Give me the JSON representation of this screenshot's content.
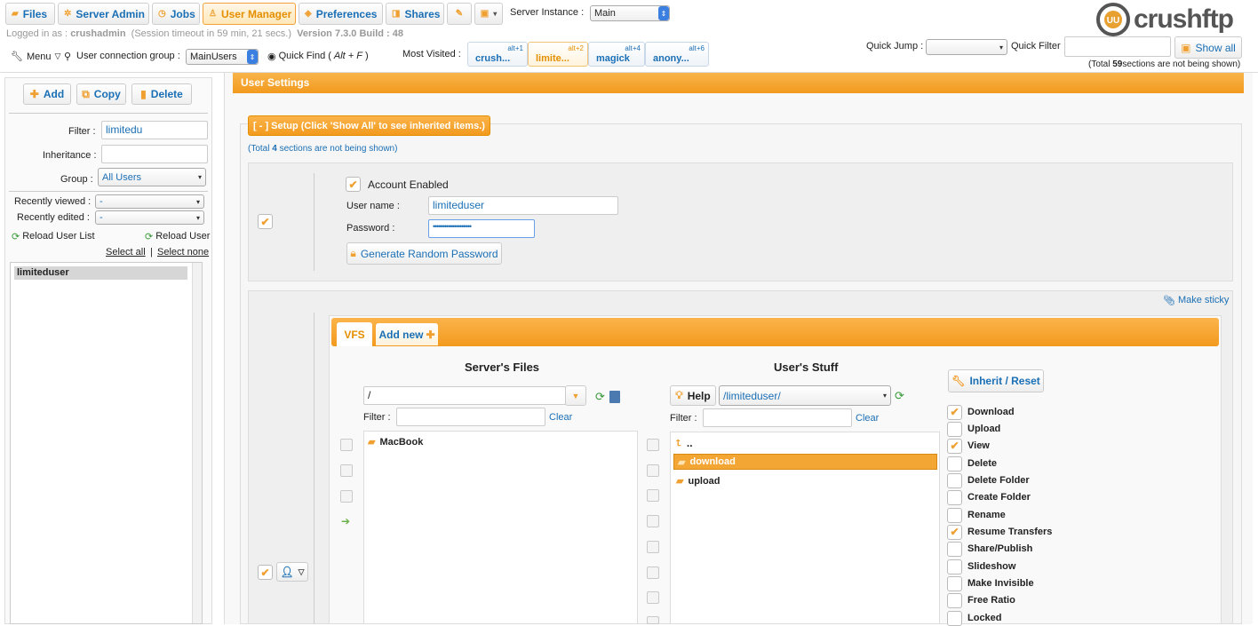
{
  "topnav": {
    "tabs": [
      {
        "label": "Files"
      },
      {
        "label": "Server Admin"
      },
      {
        "label": "Jobs"
      },
      {
        "label": "User Manager"
      },
      {
        "label": "Preferences"
      },
      {
        "label": "Shares"
      }
    ],
    "server_instance_label": "Server Instance :",
    "server_instance_value": "Main",
    "logo": "crushftp"
  },
  "session": {
    "logged_in_label": "Logged in as :",
    "user": "crushadmin",
    "timeout": "(Session timeout in 59 min, 21 secs.)",
    "version": "Version 7.3.0 Build : 48"
  },
  "toolbar": {
    "menu": "Menu",
    "group_label": "User connection group :",
    "group_value": "MainUsers",
    "quick_find": "Quick Find (",
    "quick_find_keys": "Alt + F",
    "quick_find_close": ")",
    "most_visited_label": "Most Visited :",
    "most_visited": [
      {
        "label": "crush...",
        "hotkey": "alt+1"
      },
      {
        "label": "limite...",
        "hotkey": "alt+2"
      },
      {
        "label": "magick",
        "hotkey": "alt+4"
      },
      {
        "label": "anony...",
        "hotkey": "alt+6"
      }
    ],
    "quick_jump_label": "Quick Jump :",
    "quick_filter_label": "Quick Filter",
    "show_all": "Show all",
    "hidden_note_pre": "(Total ",
    "hidden_count": "59",
    "hidden_note_post": "sections are not being shown)"
  },
  "sidebar": {
    "add": "Add",
    "copy": "Copy",
    "delete": "Delete",
    "filter_label": "Filter :",
    "filter_value": "limitedu",
    "inheritance_label": "Inheritance :",
    "group_label": "Group :",
    "group_value": "All Users",
    "recently_viewed_label": "Recently viewed :",
    "recently_viewed_value": "-",
    "recently_edited_label": "Recently edited :",
    "recently_edited_value": "-",
    "reload_list": "Reload User List",
    "reload_user": "Reload User",
    "select_all": "Select all",
    "sep": "|",
    "select_none": "Select none",
    "users": [
      "limiteduser"
    ]
  },
  "main": {
    "title": "User Settings",
    "setup_tab": "[ - ] Setup (Click 'Show All' to see inherited items.)",
    "hidden_sections_pre": "(Total ",
    "hidden_sections_count": "4",
    "hidden_sections_post": " sections are not being shown)",
    "account_enabled": "Account Enabled",
    "username_label": "User name :",
    "username_value": "limiteduser",
    "password_label": "Password :",
    "password_value": "••••••••••••••••••••",
    "generate_password": "Generate Random Password",
    "make_sticky": "Make sticky",
    "vfs_tab": "VFS",
    "add_new_tab": "Add new",
    "servers_files_title": "Server's Files",
    "server_path": "/",
    "filter_label": "Filter :",
    "clear": "Clear",
    "server_items": [
      "MacBook"
    ],
    "users_stuff_title": "User's Stuff",
    "help": "Help",
    "user_path": "/limiteduser/",
    "user_items": [
      "..",
      "download",
      "upload"
    ],
    "inherit_reset": "Inherit / Reset",
    "permissions": [
      {
        "label": "Download",
        "checked": true
      },
      {
        "label": "Upload",
        "checked": false
      },
      {
        "label": "View",
        "checked": true
      },
      {
        "label": "Delete",
        "checked": false
      },
      {
        "label": "Delete Folder",
        "checked": false
      },
      {
        "label": "Create Folder",
        "checked": false
      },
      {
        "label": "Rename",
        "checked": false
      },
      {
        "label": "Resume Transfers",
        "checked": true
      },
      {
        "label": "Share/Publish",
        "checked": false
      },
      {
        "label": "Slideshow",
        "checked": false
      },
      {
        "label": "Make Invisible",
        "checked": false
      },
      {
        "label": "Free Ratio",
        "checked": false
      },
      {
        "label": "Locked",
        "checked": false
      }
    ]
  },
  "colors": {
    "accent": "#f0a030",
    "link": "#1a6fb5",
    "header_bar": "#f6a12a"
  }
}
